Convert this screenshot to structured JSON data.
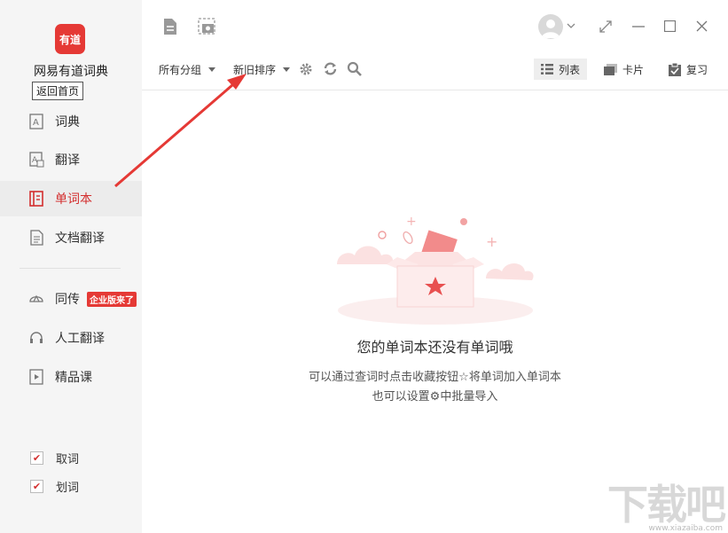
{
  "app": {
    "logo_text": "有道",
    "name": "网易有道词典",
    "tooltip": "返回首页"
  },
  "sidebar": {
    "items": [
      {
        "label": "词典"
      },
      {
        "label": "翻译"
      },
      {
        "label": "单词本",
        "active": true
      },
      {
        "label": "文档翻译"
      },
      {
        "label": "同传",
        "badge": "企业版来了"
      },
      {
        "label": "人工翻译"
      },
      {
        "label": "精品课"
      }
    ],
    "checks": [
      {
        "label": "取词",
        "checked": true
      },
      {
        "label": "划词",
        "checked": true
      }
    ]
  },
  "toolbar": {
    "group_label": "所有分组",
    "sort_label": "新旧排序",
    "views": [
      {
        "label": "列表",
        "active": true
      },
      {
        "label": "卡片"
      },
      {
        "label": "复习"
      }
    ]
  },
  "empty": {
    "title": "您的单词本还没有单词哦",
    "line1": "可以通过查词时点击收藏按钮☆将单词加入单词本",
    "line2": "也可以设置⚙中批量导入"
  },
  "watermark": {
    "text": "下载吧",
    "url": "www.xiazaiba.com"
  },
  "colors": {
    "accent": "#d32f2f",
    "sidebar_bg": "#f5f5f5",
    "arrow": "#e53935"
  }
}
